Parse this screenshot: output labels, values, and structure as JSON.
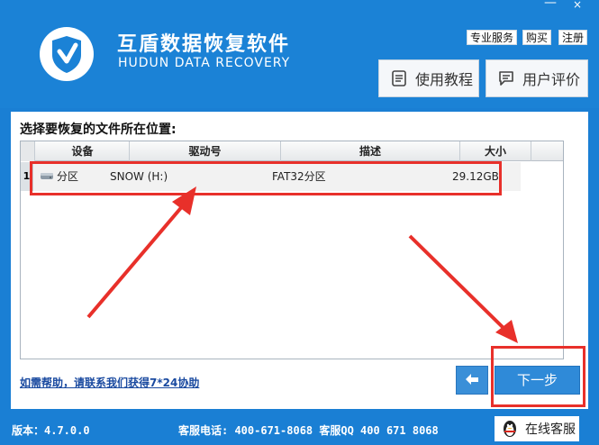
{
  "app": {
    "title": "互盾数据恢复软件",
    "subtitle": "HUDUN DATA RECOVERY"
  },
  "window_controls": {
    "minimize": "—",
    "close": "×"
  },
  "top_links": [
    "专业服务",
    "购买",
    "注册"
  ],
  "header_buttons": [
    {
      "label": "使用教程",
      "icon": "document-icon"
    },
    {
      "label": "用户评价",
      "icon": "comment-icon"
    }
  ],
  "content": {
    "prompt": "选择要恢复的文件所在位置:",
    "columns": [
      "设备",
      "驱动号",
      "描述",
      "大小"
    ],
    "rows": [
      {
        "index": "1",
        "device": "分区",
        "drive": "SNOW (H:)",
        "description": "FAT32分区",
        "size": "29.12GB"
      }
    ],
    "help_link": "如需帮助，请联系我们获得7*24协助",
    "next_label": "下一步"
  },
  "footer": {
    "version": "版本：4.7.0.0",
    "phone": "客服电话: 400-671-8068  客服QQ 400 671 8068",
    "online_service": "在线客服"
  },
  "colors": {
    "accent": "#1b82d6",
    "annotation": "#e8302a"
  }
}
